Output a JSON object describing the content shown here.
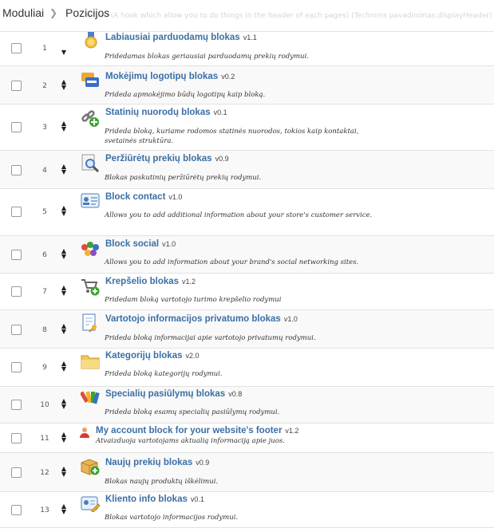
{
  "breadcrumb": {
    "ghost_text": "udulai  (A hook which allow you to do things in the header of each pages) (Techninis pavadinimas:displayHeader)",
    "item1": "Moduliai",
    "item2": "Pozicijos"
  },
  "modules": [
    {
      "number": "1",
      "name": "Labiausiai parduodamų blokas",
      "version": "v1.1",
      "description": "Pridedamas blokas geriausiai parduodamų prekių rodymui.",
      "icon": "medal-icon"
    },
    {
      "number": "2",
      "name": "Mokėjimų logotipų blokas",
      "version": "v0.2",
      "description": "Prideda apmokėjimo būdų logotipų kaip bloką.",
      "icon": "payment-cards-icon"
    },
    {
      "number": "3",
      "name": "Statinių nuorodų blokas",
      "version": "v0.1",
      "description": "Prideda bloką, kuriame rodomos statinės nuorodos, tokios kaip kontaktai, svetainės struktūra.",
      "icon": "chain-link-add-icon"
    },
    {
      "number": "4",
      "name": "Peržiūrėtų prekių blokas",
      "version": "v0.9",
      "description": "Blokas paskutinių peržiūrėtų prekių rodymui.",
      "icon": "magnifier-page-icon"
    },
    {
      "number": "5",
      "name": "Block contact",
      "version": "v1.0",
      "description": "Allows you to add additional information about your store's customer service.",
      "icon": "contact-card-icon"
    },
    {
      "number": "6",
      "name": "Block social",
      "version": "v1.0",
      "description": "Allows you to add information about your brand's social networking sites.",
      "icon": "social-people-icon"
    },
    {
      "number": "7",
      "name": "Krepšelio blokas",
      "version": "v1.2",
      "description": "Pridedam bloką vartotojo turimo krepšelio rodymui",
      "icon": "cart-add-icon"
    },
    {
      "number": "8",
      "name": "Vartotojo informacijos privatumo blokas",
      "version": "v1.0",
      "description": "Prideda bloką informacijai apie vartotojo privatumų rodymui.",
      "icon": "document-key-icon"
    },
    {
      "number": "9",
      "name": "Kategorijų blokas",
      "version": "v2.0",
      "description": "Prideda bloką kategorijų rodymui.",
      "icon": "folder-icon"
    },
    {
      "number": "10",
      "name": "Specialių pasiūlymų blokas",
      "version": "v0.8",
      "description": "Prideda bloką esamų specialių pasiūlymų rodymui.",
      "icon": "color-swatches-icon"
    },
    {
      "number": "11",
      "name": "My account block for your website's footer",
      "version": "v1.2",
      "description": "Atvaizduoja vartotojams aktualią informaciją apie juos.",
      "icon": "user-icon"
    },
    {
      "number": "12",
      "name": "Naujų prekių blokas",
      "version": "v0.9",
      "description": "Blokas naujų produktų iškėlimui.",
      "icon": "box-add-icon"
    },
    {
      "number": "13",
      "name": "Kliento info blokas",
      "version": "v0.1",
      "description": "Blokas vartotojo informacijos rodymui.",
      "icon": "id-card-edit-icon"
    }
  ]
}
